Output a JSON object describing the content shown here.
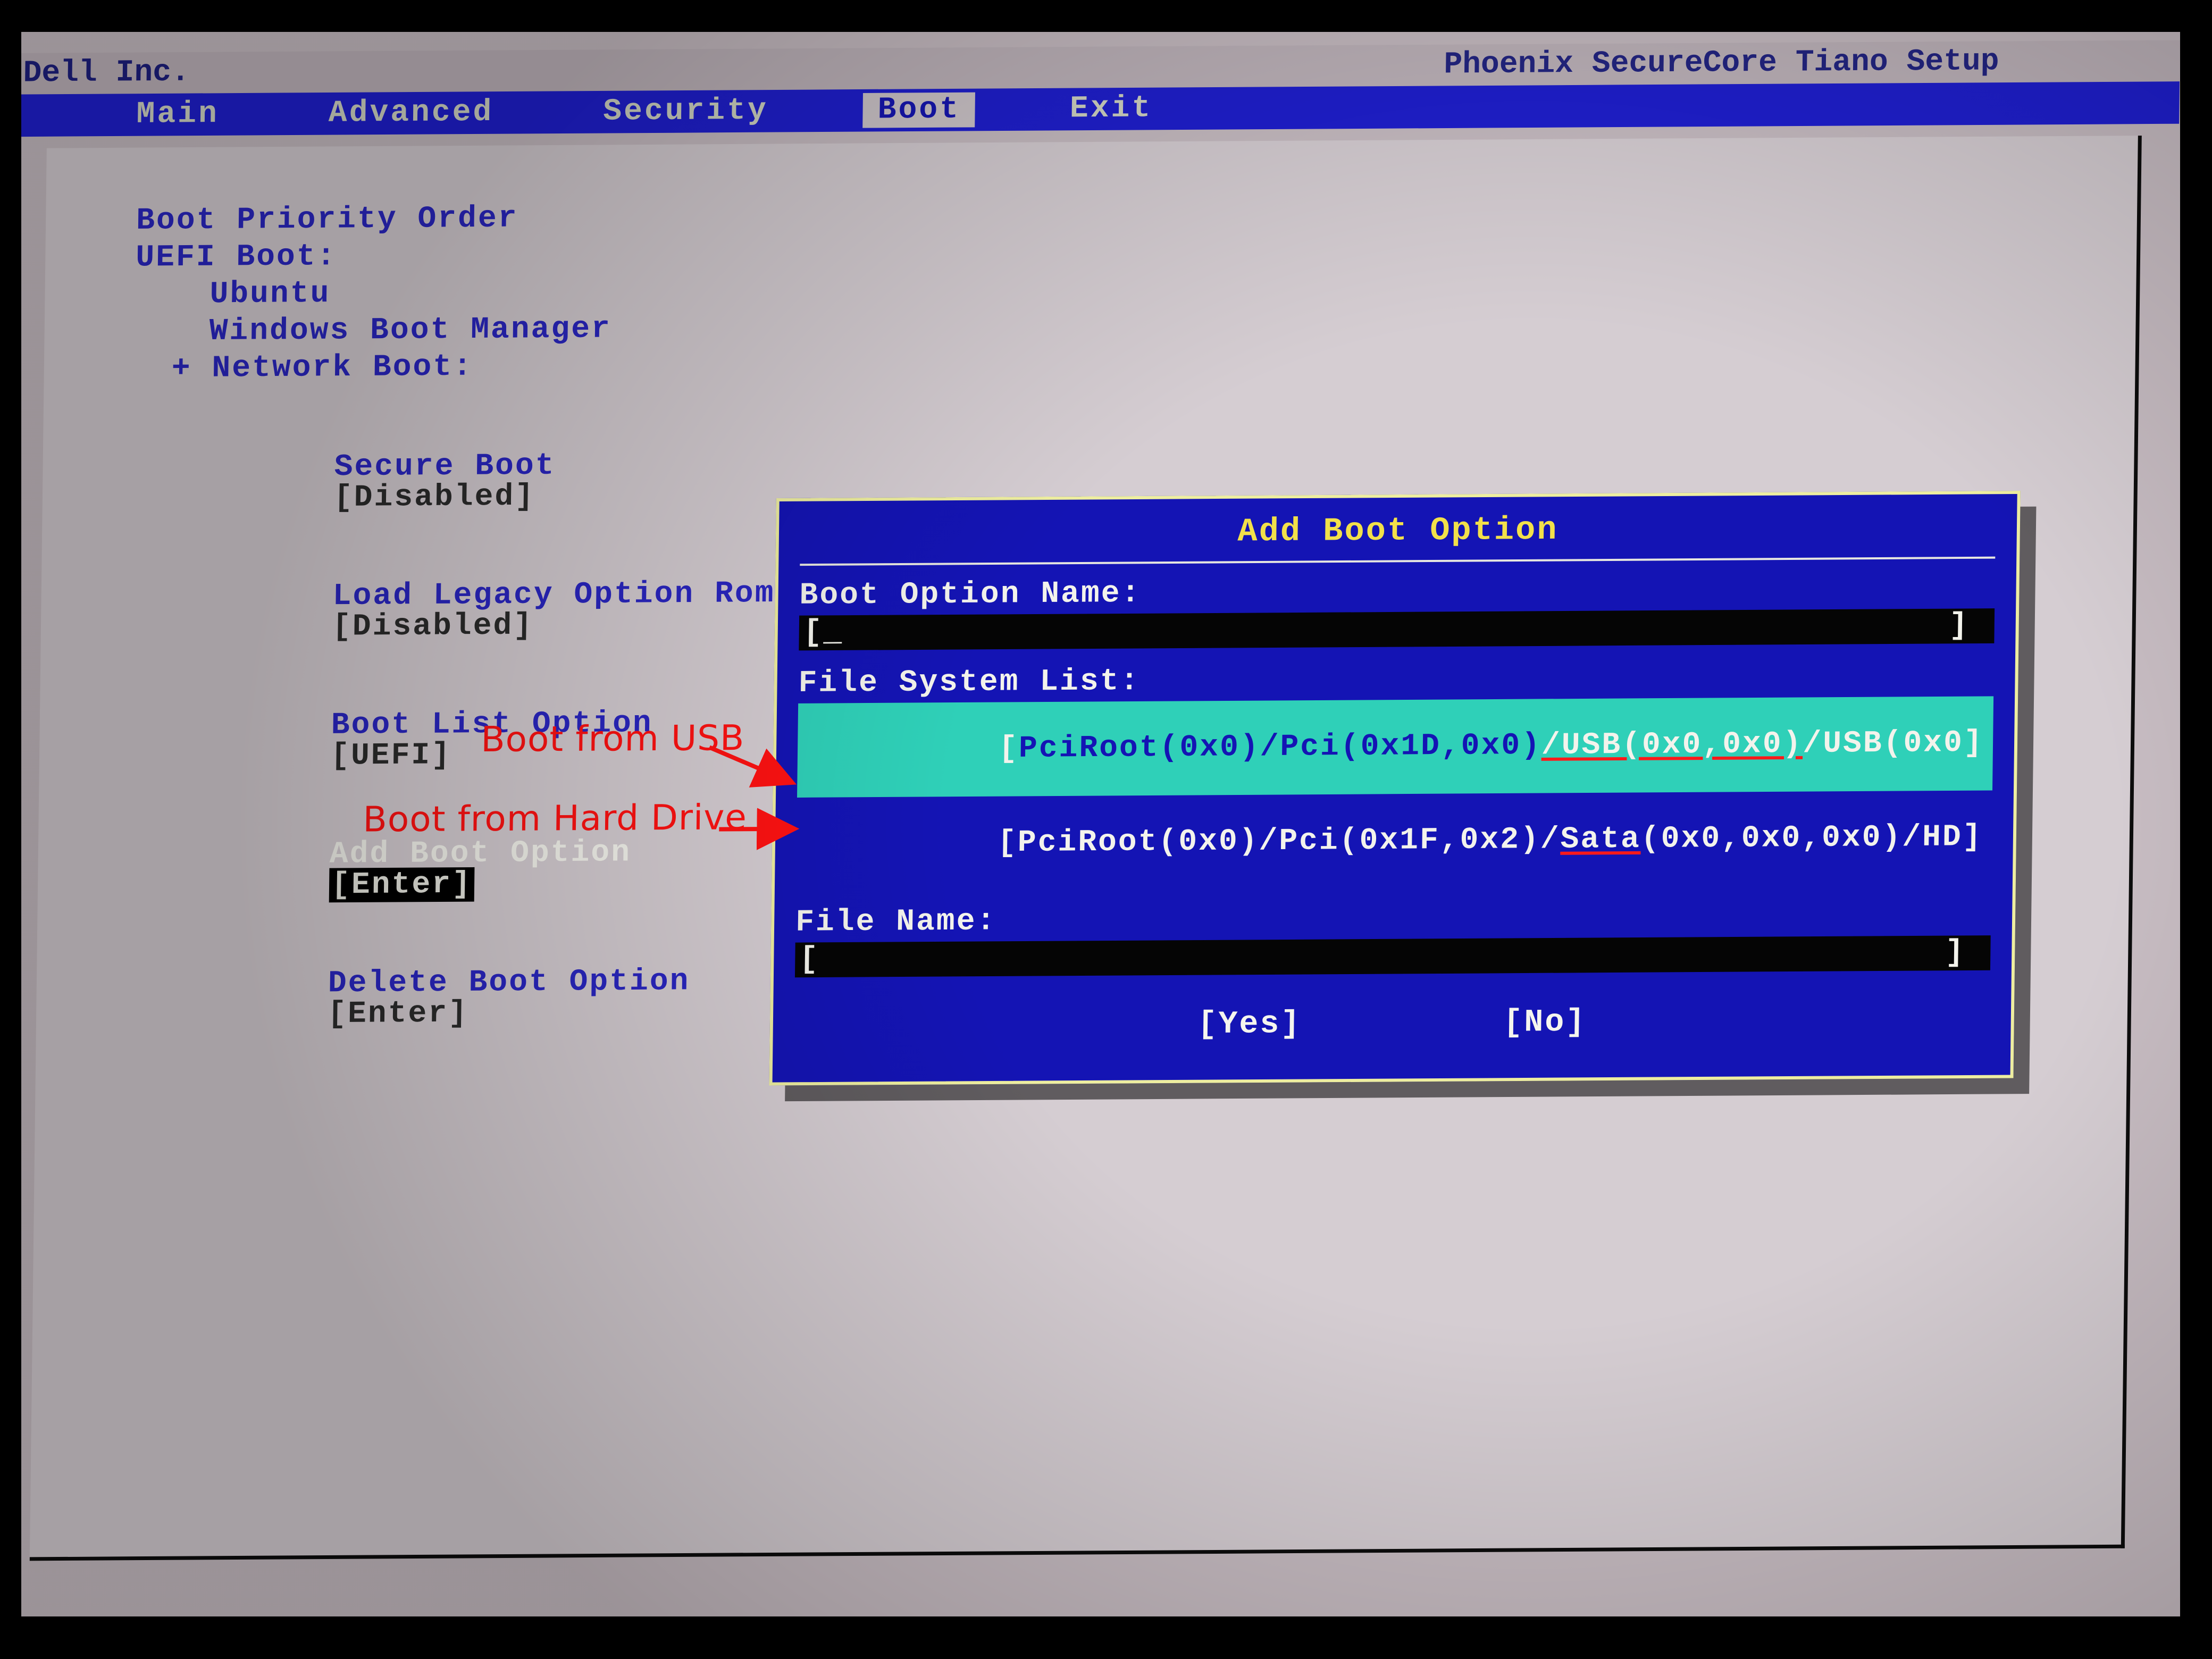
{
  "titlebar": {
    "vendor": "Dell Inc.",
    "product": "Phoenix SecureCore Tiano Setup"
  },
  "menubar": {
    "tabs": [
      "Main",
      "Advanced",
      "Security",
      "Boot",
      "Exit"
    ],
    "active": "Boot"
  },
  "boot_pane": {
    "heading": "Boot Priority Order",
    "uefi_label": "UEFI Boot:",
    "uefi_items": [
      "Ubuntu",
      "Windows Boot Manager"
    ],
    "network_label": "+ Network Boot:",
    "options": [
      {
        "name": "Secure Boot",
        "value": "[Disabled]",
        "highlight": false
      },
      {
        "name": "Load Legacy Option Rom",
        "value": "[Disabled]",
        "highlight": false
      },
      {
        "name": "Boot List Option",
        "value": "[UEFI]",
        "highlight": false
      },
      {
        "name": "Add Boot Option",
        "value": "[Enter]",
        "highlight": true
      },
      {
        "name": "Delete Boot Option",
        "value": "[Enter]",
        "highlight": false
      }
    ]
  },
  "dialog": {
    "title": "Add Boot Option",
    "name_label": "Boot Option Name:",
    "name_value": "[_                                                       ]",
    "fslist_label": "File System List:",
    "fslist": [
      {
        "text_pre": "[",
        "text_a": "PciRoot(0x0)/Pci(0x1D,0x0)",
        "text_b": "/USB(0x0,0x0)",
        "text_c": "/USB(0x0]",
        "usb": true,
        "hi": true
      },
      {
        "text_pre": "[",
        "text_a": "PciRoot(0x0)/Pci(0x1F,0x2)/",
        "text_b": "Sata",
        "text_c": "(0x0,0x0,0x0)/HD]",
        "usb": false,
        "hi": false
      }
    ],
    "file_label": "File Name:",
    "file_value": "[                                                        ]",
    "buttons": {
      "yes": "[Yes]",
      "no": "[No]"
    }
  },
  "annotations": {
    "usb": "Boot from USB",
    "hdd": "Boot from Hard Drive"
  }
}
